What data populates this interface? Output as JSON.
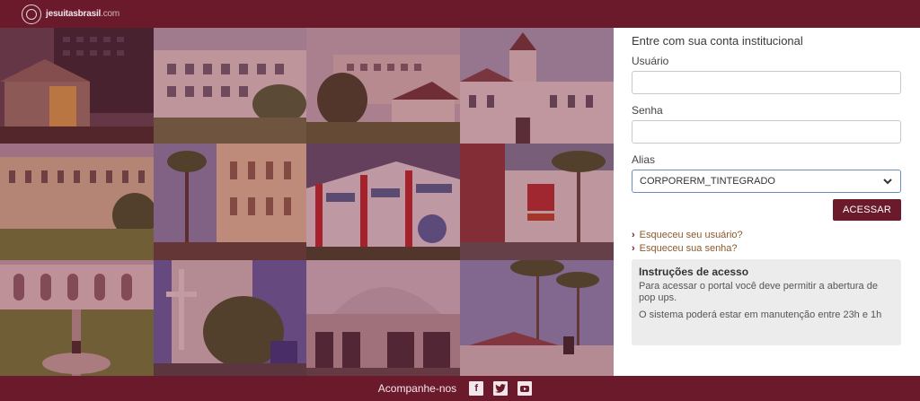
{
  "brand": {
    "name": "jesuitasbrasil",
    "domain": ".com"
  },
  "login": {
    "heading": "Entre com sua conta institucional",
    "user_label": "Usuário",
    "user_value": "",
    "password_label": "Senha",
    "password_value": "",
    "alias_label": "Alias",
    "alias_selected": "CORPORERM_TINTEGRADO",
    "submit_label": "ACESSAR",
    "forgot_user": "Esqueceu seu usuário?",
    "forgot_password": "Esqueceu sua senha?"
  },
  "instructions": {
    "title": "Instruções de acesso",
    "line1": "Para acessar o portal você deve permitir a abertura de pop ups.",
    "line2": "O sistema poderá estar em manutenção entre 23h e 1h"
  },
  "footer": {
    "follow_label": "Acompanhe-nos"
  },
  "colors": {
    "brand": "#6b1a2c",
    "link": "#8a5a2a",
    "focus": "#6a8fc4"
  }
}
